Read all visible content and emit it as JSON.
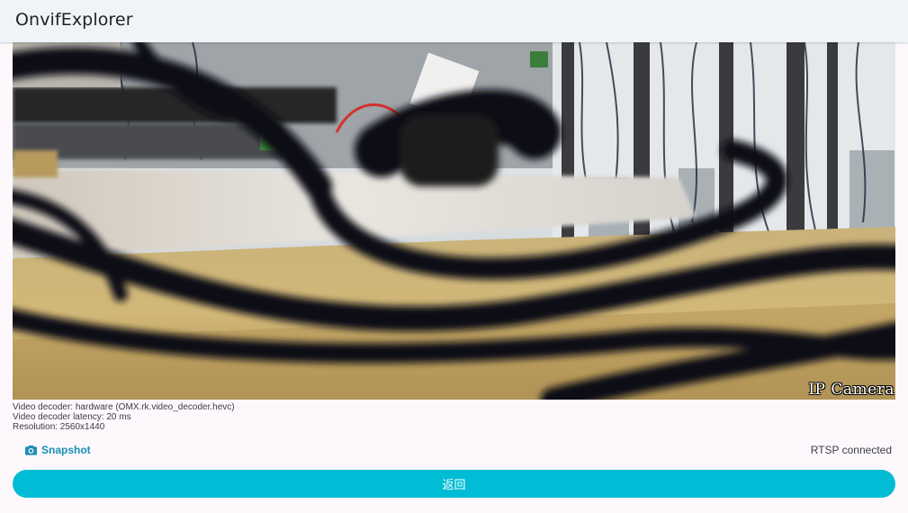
{
  "app": {
    "title": "OnvifExplorer"
  },
  "video": {
    "osd_text": "IP Camera"
  },
  "stream_info": {
    "decoder": "Video decoder: hardware (OMX.rk.video_decoder.hevc)",
    "latency": "Video decoder latency: 20 ms",
    "resolution": "Resolution: 2560x1440"
  },
  "controls": {
    "snapshot_label": "Snapshot",
    "snapshot_icon": "camera-icon",
    "status_text": "RTSP connected",
    "back_label": "返回"
  },
  "colors": {
    "appbar_bg": "#eff4f9",
    "page_bg": "#fcf8fc",
    "accent": "#00bcd4",
    "link": "#1a8fb4"
  }
}
